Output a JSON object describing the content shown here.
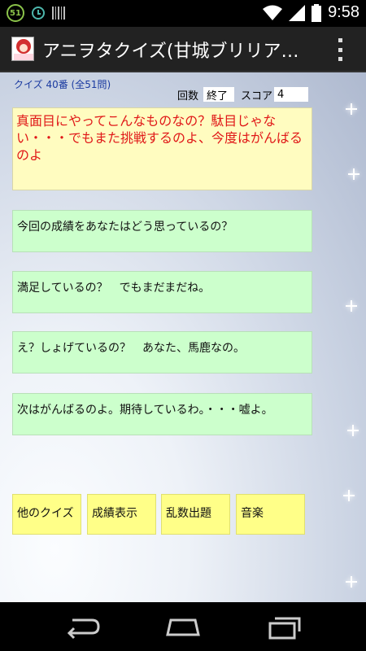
{
  "status": {
    "badge": "51",
    "time": "9:58"
  },
  "actionbar": {
    "title": "アニヲタクイズ(甘城ブリリア…"
  },
  "quiz": {
    "info": "クイズ 40番 (全51問)",
    "round_label": "回数",
    "round_value": "終了",
    "score_label": "スコア",
    "score_value": "4"
  },
  "question": {
    "text": "真面目にやってこんなものなの？駄目じゃない・・・でもまた挑戦するのよ、今度はがんばるのよ"
  },
  "answers": [
    "今回の成績をあなたはどう思っているの？",
    "満足しているの？　でもまだまだね。",
    "え？しょげているの？　あなた、馬鹿なの。",
    "次はがんばるのよ。期待しているわ。・・・嘘よ。"
  ],
  "menu": [
    "他のクイズ",
    "成績表示",
    "乱数出題",
    "音楽"
  ],
  "icons": {
    "overflow": "overflow-menu-icon",
    "back": "back-icon",
    "home": "home-icon",
    "recents": "recents-icon",
    "wifi": "wifi-icon",
    "battery": "battery-icon"
  },
  "colors": {
    "question_bg": "#fffcc0",
    "question_text": "#e01818",
    "answer_bg": "#ccffcc",
    "menu_bg": "#ffff88",
    "info_text": "#1a3aa0"
  }
}
